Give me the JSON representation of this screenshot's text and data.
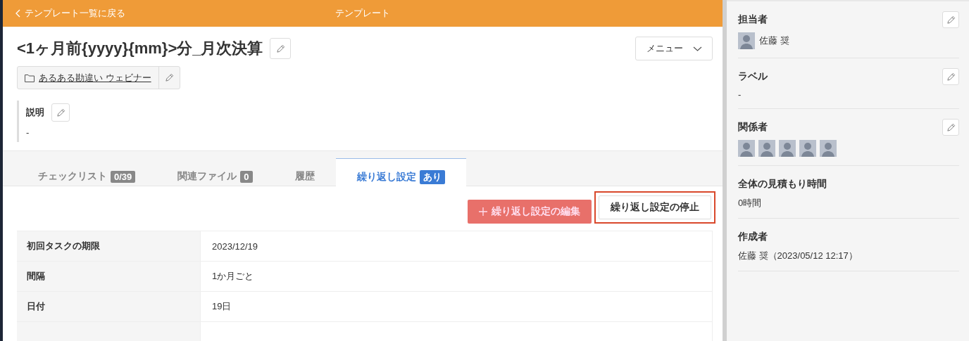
{
  "header": {
    "back_link": "テンプレート一覧に戻る",
    "title": "テンプレート"
  },
  "template": {
    "title": "<1ヶ月前{yyyy}{mm}>分_月次決算",
    "folder": "あるある勘違い ウェビナー",
    "menu_button": "メニュー",
    "description": {
      "label": "説明",
      "value": "-"
    }
  },
  "tabs": [
    {
      "label": "チェックリスト",
      "badge": "0/39",
      "selected": false
    },
    {
      "label": "関連ファイル",
      "badge": "0",
      "selected": false
    },
    {
      "label": "履歴",
      "selected": false
    },
    {
      "label": "繰り返し設定",
      "badge": "あり",
      "selected": true
    }
  ],
  "actions": [
    {
      "label": "繰り返し設定の編集",
      "kind": "primary",
      "highlighted": false
    },
    {
      "label": "繰り返し設定の停止",
      "kind": "secondary",
      "highlighted": true
    }
  ],
  "settings_table": {
    "rows": [
      {
        "label": "初回タスクの期限",
        "value": "2023/12/19"
      },
      {
        "label": "間隔",
        "value": "1か月ごと"
      },
      {
        "label": "日付",
        "value": "19日"
      }
    ]
  },
  "sidebar": {
    "sections": [
      {
        "title": "担当者",
        "editable": true,
        "kind": "person",
        "name": "佐藤 奨"
      },
      {
        "title": "ラベル",
        "editable": true,
        "kind": "text",
        "value": "-"
      },
      {
        "title": "関係者",
        "editable": true,
        "kind": "avatars",
        "members": [
          {
            "kind": "photo"
          },
          {
            "kind": "photo"
          },
          {
            "kind": "photo"
          },
          {
            "kind": "photo"
          },
          {
            "kind": "photo"
          }
        ]
      },
      {
        "title": "全体の見積もり時間",
        "editable": false,
        "kind": "text",
        "value": "0時間"
      },
      {
        "title": "作成者",
        "editable": false,
        "kind": "text",
        "value": "佐藤 奨（2023/05/12 12:17）"
      }
    ]
  }
}
